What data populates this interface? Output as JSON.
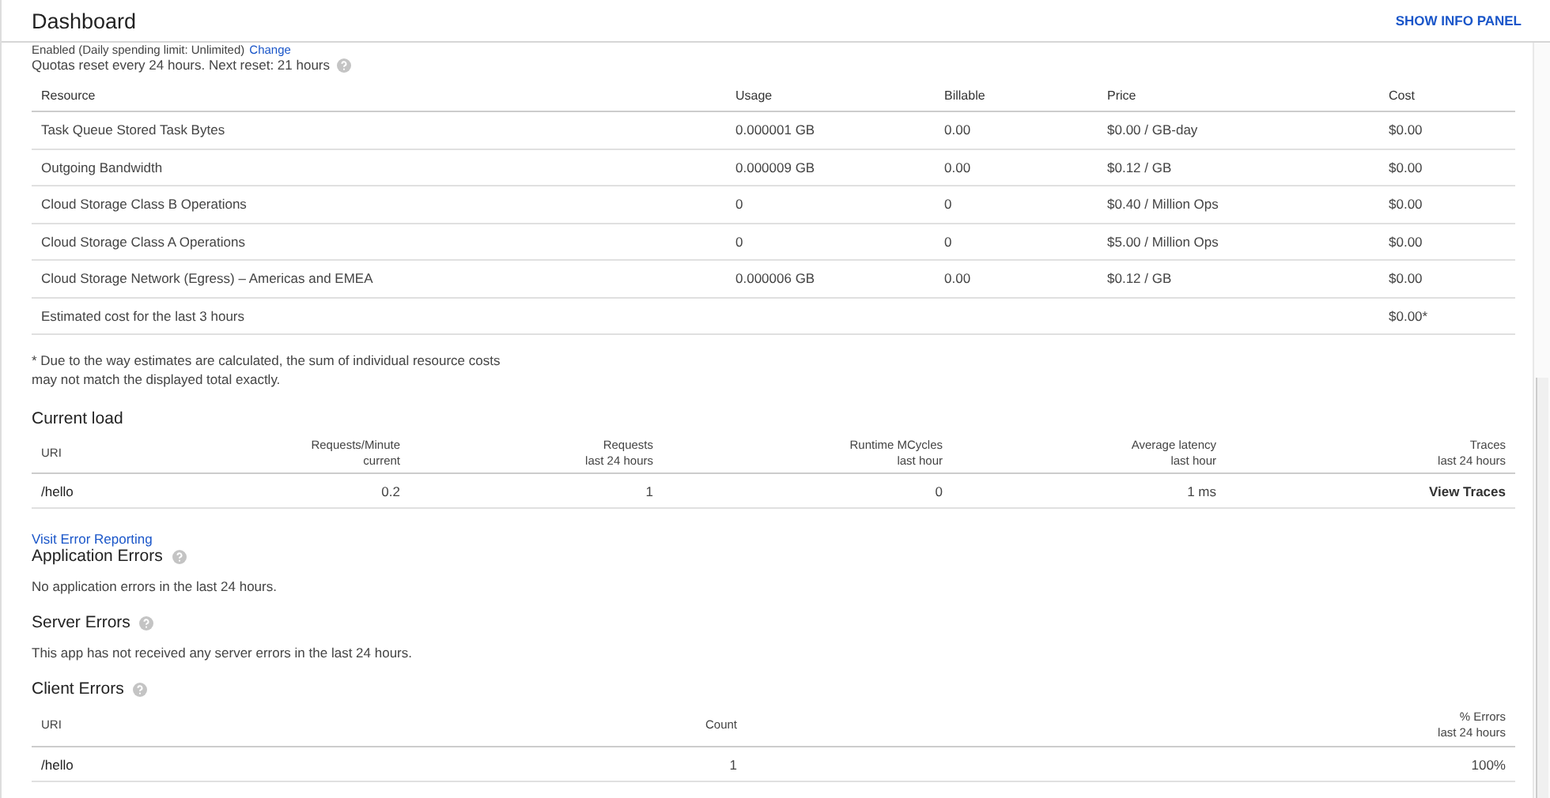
{
  "header": {
    "title": "Dashboard",
    "action": "SHOW INFO PANEL"
  },
  "billing": {
    "status": "Enabled (Daily spending limit: Unlimited)",
    "link": "Change"
  },
  "quota": {
    "text": "Quotas reset every 24 hours. Next reset: 21 hours"
  },
  "resources": {
    "columns": [
      "Resource",
      "Usage",
      "Billable",
      "Price",
      "Cost"
    ],
    "rows": [
      [
        "Task Queue Stored Task Bytes",
        "0.000001 GB",
        "0.00",
        "$0.00 / GB-day",
        "$0.00"
      ],
      [
        "Outgoing Bandwidth",
        "0.000009 GB",
        "0.00",
        "$0.12 / GB",
        "$0.00"
      ],
      [
        "Cloud Storage Class B Operations",
        "0",
        "0",
        "$0.40 / Million Ops",
        "$0.00"
      ],
      [
        "Cloud Storage Class A Operations",
        "0",
        "0",
        "$5.00 / Million Ops",
        "$0.00"
      ],
      [
        "Cloud Storage Network (Egress) – Americas and EMEA",
        "0.000006 GB",
        "0.00",
        "$0.12 / GB",
        "$0.00"
      ]
    ],
    "total": {
      "label": "Estimated cost for the last 3 hours",
      "cost": "$0.00*"
    }
  },
  "footnote": [
    "* Due to the way estimates are calculated, the sum of individual resource costs",
    "may not match the displayed total exactly."
  ],
  "current_load": {
    "title": "Current load",
    "columns": [
      {
        "name": "URI"
      },
      {
        "name": "Requests/Minute",
        "sub": "current"
      },
      {
        "name": "Requests",
        "sub": "last 24 hours"
      },
      {
        "name": "Runtime MCycles",
        "sub": "last hour"
      },
      {
        "name": "Average latency",
        "sub": "last hour"
      },
      {
        "name": "Traces",
        "sub": "last 24 hours"
      }
    ],
    "rows": [
      {
        "cells": [
          "/hello",
          "0.2",
          "1",
          "0",
          "1 ms"
        ],
        "action": "View Traces"
      }
    ]
  },
  "error_reporting_link": "Visit Error Reporting",
  "application_errors": {
    "title": "Application Errors",
    "message": "No application errors in the last 24 hours."
  },
  "server_errors": {
    "title": "Server Errors",
    "message": "This app has not received any server errors in the last 24 hours."
  },
  "client_errors": {
    "title": "Client Errors",
    "columns": [
      {
        "name": "URI"
      },
      {
        "name": "Count"
      },
      {
        "name": "% Errors",
        "sub": "last 24 hours"
      }
    ],
    "rows": [
      [
        "/hello",
        "1",
        "100%"
      ]
    ]
  }
}
